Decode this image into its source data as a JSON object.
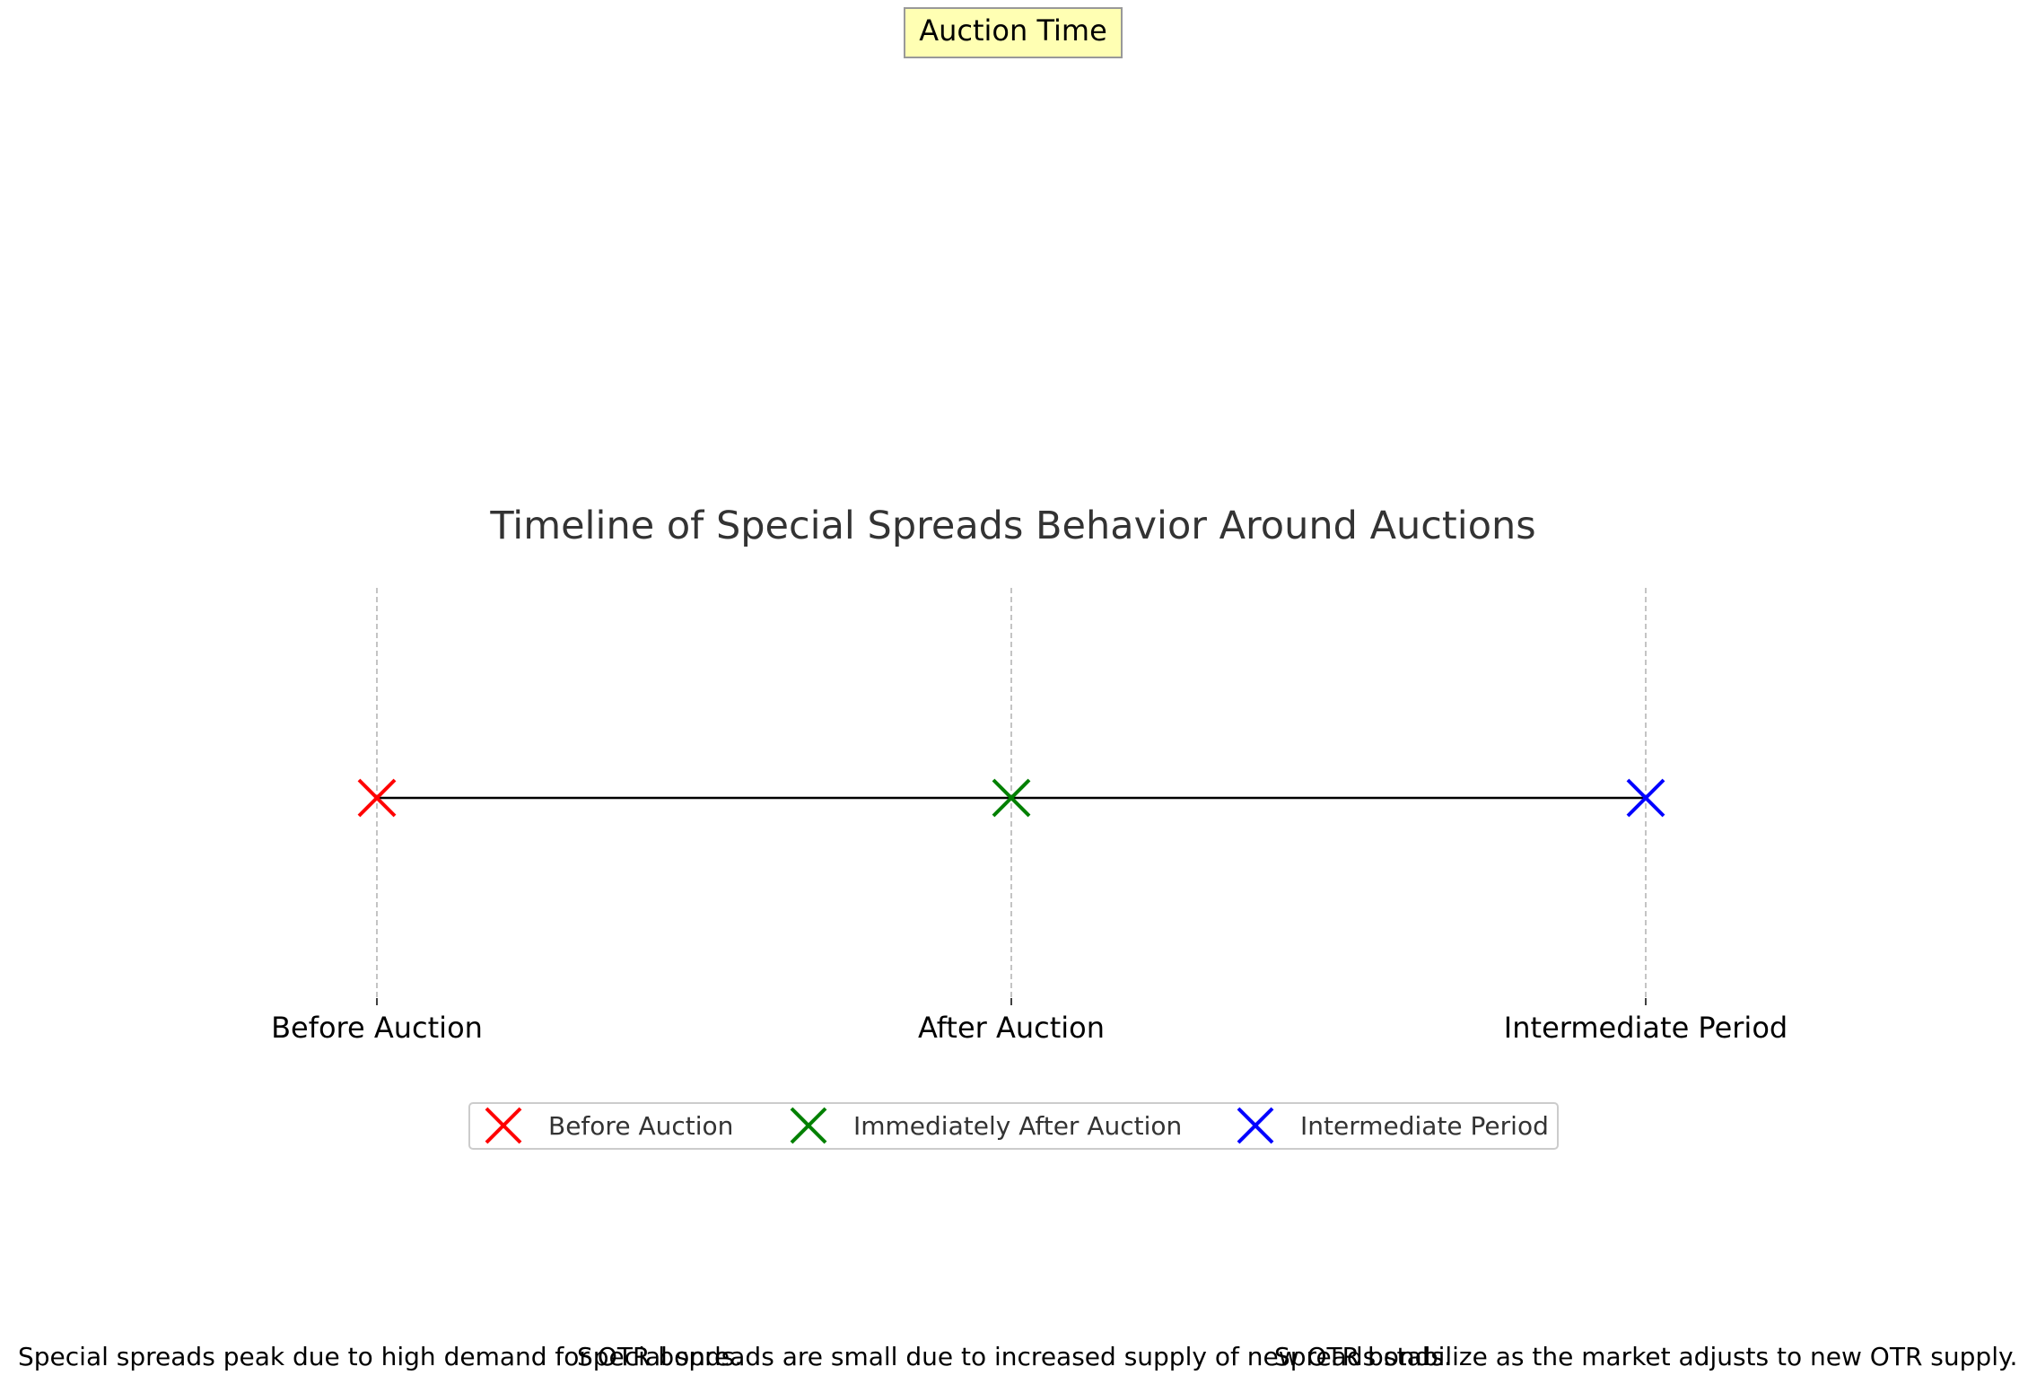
{
  "chart_data": {
    "type": "scatter",
    "title": "Timeline of Special Spreads Behavior Around Auctions",
    "xlabel": "",
    "ylabel": "",
    "x_ticks": [
      "Before Auction",
      "After Auction",
      "Intermediate Period"
    ],
    "xlim": [
      -0.6,
      2.6
    ],
    "grid": "vertical dashed at ticks",
    "connecting_line": true,
    "marker": "x",
    "series": [
      {
        "name": "Before Auction",
        "x": 0,
        "y": 0,
        "color": "#ff0000"
      },
      {
        "name": "Immediately After Auction",
        "x": 1,
        "y": 0,
        "color": "#008000"
      },
      {
        "name": "Intermediate Period",
        "x": 2,
        "y": 0,
        "color": "#0000ff"
      }
    ],
    "annotation_box": "Auction Time",
    "annotation_box_color": "#ffffb3",
    "legend": {
      "placement": "lower-center",
      "entries": [
        "Before Auction",
        "Immediately After Auction",
        "Intermediate Period"
      ]
    },
    "notes": [
      "Special spreads peak due to high demand for OTR bonds.",
      "Special spreads are small due to increased supply of new OTR bonds.",
      "Spreads stabilize as the market adjusts to new OTR supply."
    ]
  }
}
